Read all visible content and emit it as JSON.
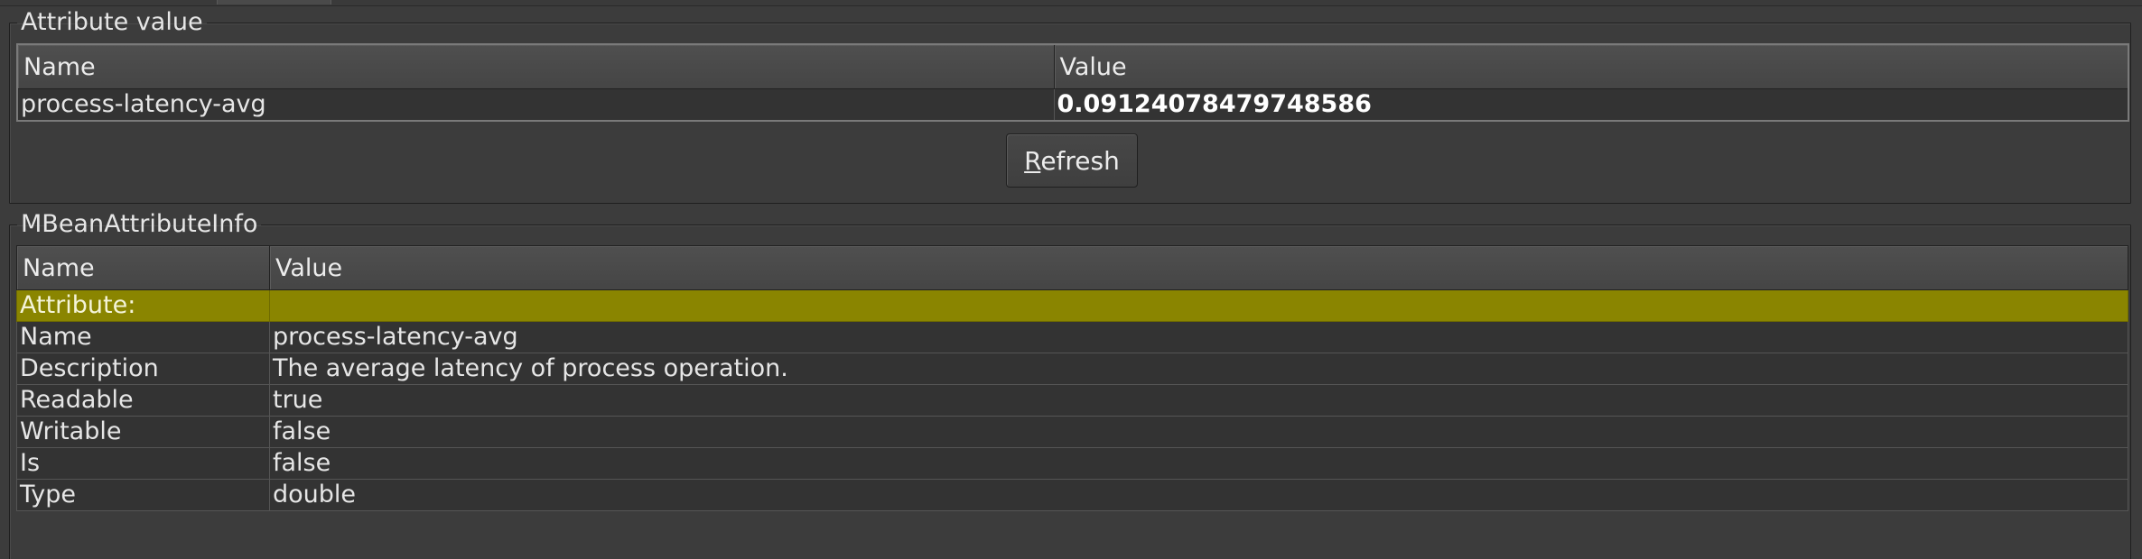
{
  "attribute_value": {
    "legend": "Attribute value",
    "columns": [
      "Name",
      "Value"
    ],
    "row": {
      "name": "process-latency-avg",
      "value": "0.09124078479748586"
    },
    "refresh_mnemonic": "R",
    "refresh_rest": "efresh"
  },
  "mbean_info": {
    "legend": "MBeanAttributeInfo",
    "columns": [
      "Name",
      "Value"
    ],
    "section_label": "Attribute:",
    "rows": [
      {
        "name": "Name",
        "value": "process-latency-avg"
      },
      {
        "name": "Description",
        "value": "The average latency of process operation."
      },
      {
        "name": "Readable",
        "value": "true"
      },
      {
        "name": "Writable",
        "value": "false"
      },
      {
        "name": "Is",
        "value": "false"
      },
      {
        "name": "Type",
        "value": "double"
      }
    ]
  },
  "colors": {
    "background": "#3c3c3c",
    "section_highlight": "#8a8500"
  }
}
